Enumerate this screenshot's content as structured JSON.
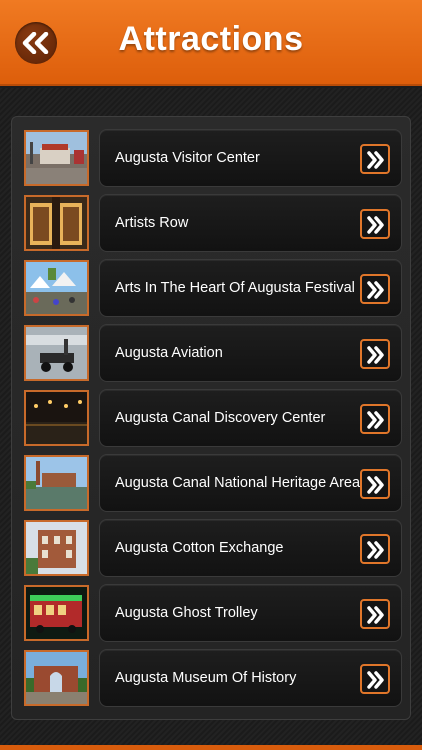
{
  "header": {
    "title": "Attractions"
  },
  "colors": {
    "accent": "#e0762a",
    "header_orange": "#ec6f18"
  },
  "attractions": [
    {
      "label": "Augusta Visitor Center",
      "thumb": "visitor-center-photo"
    },
    {
      "label": "Artists Row",
      "thumb": "artists-row-photo"
    },
    {
      "label": "Arts In The Heart Of Augusta Festival",
      "thumb": "festival-photo"
    },
    {
      "label": "Augusta Aviation",
      "thumb": "aviation-photo"
    },
    {
      "label": "Augusta Canal Discovery Center",
      "thumb": "canal-discovery-photo"
    },
    {
      "label": "Augusta Canal National Heritage Area",
      "thumb": "canal-heritage-photo"
    },
    {
      "label": "Augusta Cotton Exchange",
      "thumb": "cotton-exchange-photo"
    },
    {
      "label": "Augusta Ghost Trolley",
      "thumb": "ghost-trolley-photo"
    },
    {
      "label": "Augusta Museum Of History",
      "thumb": "museum-photo"
    }
  ]
}
